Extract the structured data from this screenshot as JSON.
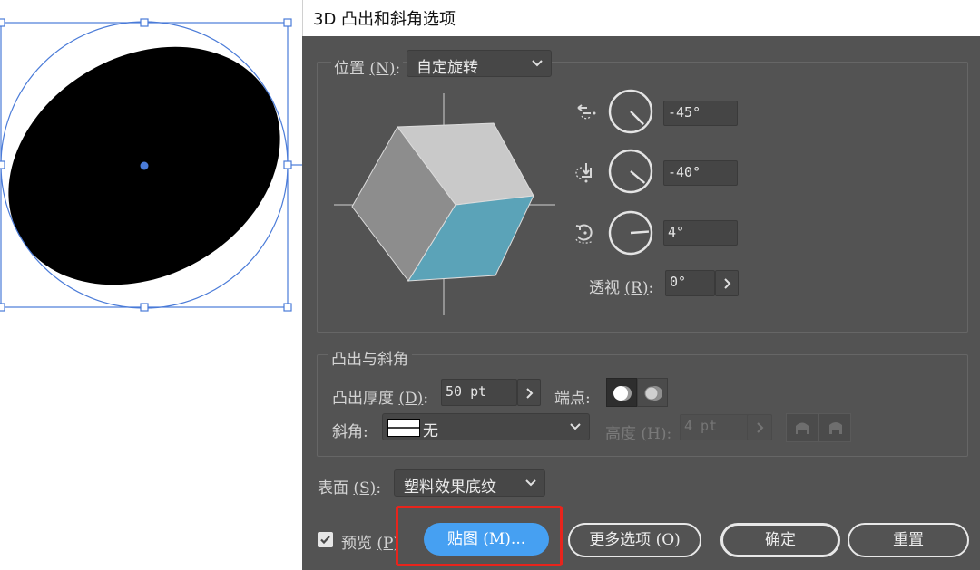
{
  "dialog": {
    "title": "3D 凸出和斜角选项",
    "position": {
      "label": "位置",
      "shortcut": "(N)",
      "colon": ":",
      "preset": "自定旋转",
      "x_rotation": "-45°",
      "y_rotation": "-40°",
      "z_rotation": "4°",
      "perspective_label": "透视",
      "perspective_shortcut": "(R)",
      "perspective_value": "0°"
    },
    "extrude_bevel": {
      "legend": "凸出与斜角",
      "depth_label": "凸出厚度",
      "depth_shortcut": "(D)",
      "depth_value": "50 pt",
      "cap_label": "端点",
      "bevel_label": "斜角",
      "bevel_value": "无",
      "height_label": "高度",
      "height_shortcut": "(H)",
      "height_value": "4 pt"
    },
    "surface": {
      "label": "表面",
      "shortcut": "(S)",
      "value": "塑料效果底纹"
    },
    "footer": {
      "preview_label": "预览",
      "preview_shortcut": "(P)",
      "preview_checked": true,
      "map_button": "贴图 (M)...",
      "more_options_button": "更多选项 (O)",
      "ok_button": "确定",
      "reset_button": "重置"
    }
  },
  "colors": {
    "dialog_bg": "#535353",
    "accent": "#46a0f2",
    "selection": "#4a7bd8",
    "highlight_box": "#e8241c",
    "cube_front": "#5ba3b8"
  },
  "dials": [
    {
      "name": "x-axis",
      "angle_deg": -45
    },
    {
      "name": "y-axis",
      "angle_deg": -40
    },
    {
      "name": "z-axis",
      "angle_deg": 4
    }
  ]
}
